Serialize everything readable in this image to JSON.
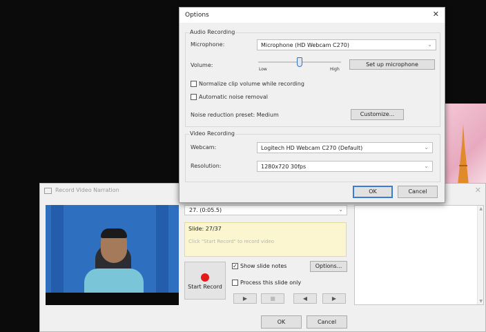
{
  "record_window": {
    "title": "Record Video Narration",
    "close_glyph": "✕",
    "slide_select": "27. (0:05.5)",
    "slide_info": "Slide: 27/37",
    "hint": "Click \"Start Record\" to record video",
    "start_record_label": "Start Record",
    "show_slide_notes_label": "Show slide notes",
    "show_slide_notes_checked": true,
    "process_slide_only_label": "Process this slide only",
    "process_slide_only_checked": false,
    "options_label": "Options...",
    "ok_label": "OK",
    "cancel_label": "Cancel",
    "toolbar_icons": [
      "play-icon",
      "stop-icon",
      "previous-icon",
      "next-icon"
    ],
    "toolbar_glyphs": {
      "play": "▶",
      "stop": "■",
      "prev": "◀",
      "next": "▶"
    }
  },
  "options_dialog": {
    "title": "Options",
    "close_glyph": "✕",
    "audio": {
      "group_title": "Audio Recording",
      "microphone_label": "Microphone:",
      "microphone_value": "Microphone (HD Webcam C270)",
      "volume_label": "Volume:",
      "volume_low": "Low",
      "volume_high": "High",
      "volume_level": 0.5,
      "setup_mic_label": "Set up microphone",
      "normalize_label": "Normalize clip volume while recording",
      "normalize_checked": false,
      "noise_removal_label": "Automatic noise removal",
      "noise_removal_checked": false,
      "noise_preset_label": "Noise reduction preset: Medium",
      "customize_label": "Customize..."
    },
    "video": {
      "group_title": "Video Recording",
      "webcam_label": "Webcam:",
      "webcam_value": "Logitech HD Webcam C270 (Default)",
      "resolution_label": "Resolution:",
      "resolution_value": "1280x720 30fps"
    },
    "ok_label": "OK",
    "cancel_label": "Cancel"
  },
  "colors": {
    "record_dot": "#e51a1a",
    "info_bg": "#fbf6cf",
    "default_button_border": "#3a7bd5",
    "screen_bg": "#0b0b0b"
  }
}
